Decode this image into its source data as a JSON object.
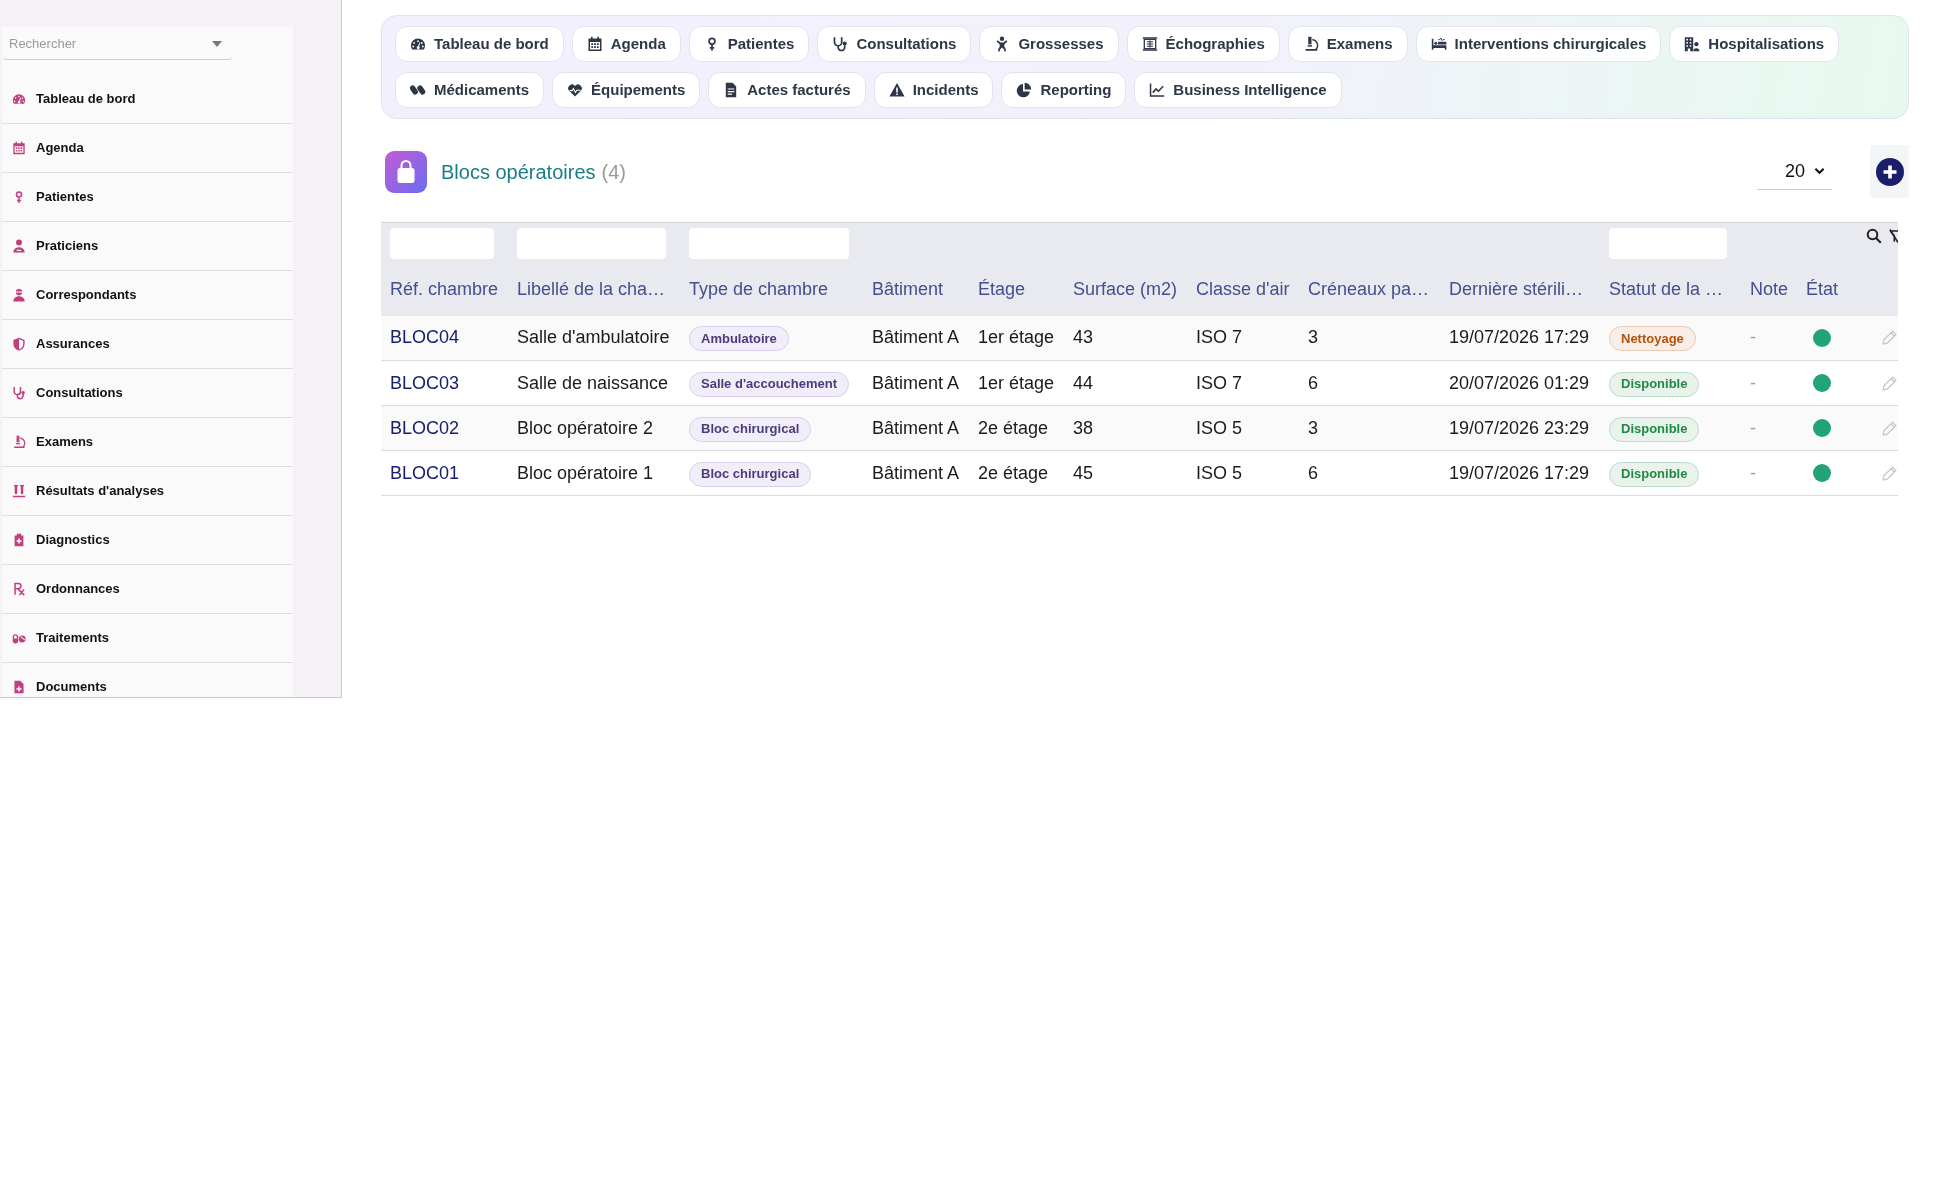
{
  "sidebar": {
    "search": {
      "placeholder": "Rechercher"
    },
    "items": [
      "Tableau de bord",
      "Agenda",
      "Patientes",
      "Praticiens",
      "Correspondants",
      "Assurances",
      "Consultations",
      "Examens",
      "Résultats d'analyses",
      "Diagnostics",
      "Ordonnances",
      "Traitements",
      "Documents"
    ]
  },
  "quick_tabs": [
    "Tableau de bord",
    "Agenda",
    "Patientes",
    "Consultations",
    "Grossesses",
    "Échographies",
    "Examens",
    "Interventions chirurgicales",
    "Hospitalisations",
    "Médicaments",
    "Équipements",
    "Actes facturés",
    "Incidents",
    "Reporting",
    "Business Intelligence"
  ],
  "header": {
    "title": "Blocs opératoires",
    "count": "(4)",
    "page_size": "20"
  },
  "table": {
    "columns": [
      {
        "label": "Réf. chambre",
        "filter_field": true
      },
      {
        "label": "Libellé de la cha…",
        "filter_field": true
      },
      {
        "label": "Type de chambre",
        "filter_field": true
      },
      {
        "label": "Bâtiment",
        "filter_field": false
      },
      {
        "label": "Étage",
        "filter_field": false
      },
      {
        "label": "Surface (m2)",
        "filter_field": false
      },
      {
        "label": "Classe d'air",
        "filter_field": false
      },
      {
        "label": "Créneaux pa…",
        "filter_field": false
      },
      {
        "label": "Dernière stérili…",
        "filter_field": false
      },
      {
        "label": "Statut de la …",
        "filter_field": true
      },
      {
        "label": "Note",
        "filter_field": false
      },
      {
        "label": "État",
        "filter_field": false
      }
    ],
    "rows": [
      {
        "ref": "BLOC04",
        "label": "Salle d'ambulatoire",
        "type": "Ambulatoire",
        "building": "Bâtiment A",
        "floor": "1er étage",
        "surface": "43",
        "air_class": "ISO 7",
        "slots": "3",
        "last_sterilization": "19/07/2026 17:29",
        "status": {
          "text": "Nettoyage",
          "color": "#b4530a"
        },
        "note": "-",
        "active": true
      },
      {
        "ref": "BLOC03",
        "label": "Salle de naissance",
        "type": "Salle d'accouchement",
        "building": "Bâtiment A",
        "floor": "1er étage",
        "surface": "44",
        "air_class": "ISO 7",
        "slots": "6",
        "last_sterilization": "20/07/2026 01:29",
        "status": {
          "text": "Disponible",
          "color": "#1f8a44"
        },
        "note": "-",
        "active": true
      },
      {
        "ref": "BLOC02",
        "label": "Bloc opératoire 2",
        "type": "Bloc chirurgical",
        "building": "Bâtiment A",
        "floor": "2e étage",
        "surface": "38",
        "air_class": "ISO 5",
        "slots": "3",
        "last_sterilization": "19/07/2026 23:29",
        "status": {
          "text": "Disponible",
          "color": "#1f8a44"
        },
        "note": "-",
        "active": true
      },
      {
        "ref": "BLOC01",
        "label": "Bloc opératoire 1",
        "type": "Bloc chirurgical",
        "building": "Bâtiment A",
        "floor": "2e étage",
        "surface": "45",
        "air_class": "ISO 5",
        "slots": "6",
        "last_sterilization": "19/07/2026 17:29",
        "status": {
          "text": "Disponible",
          "color": "#1f8a44"
        },
        "note": "-",
        "active": true
      }
    ]
  }
}
